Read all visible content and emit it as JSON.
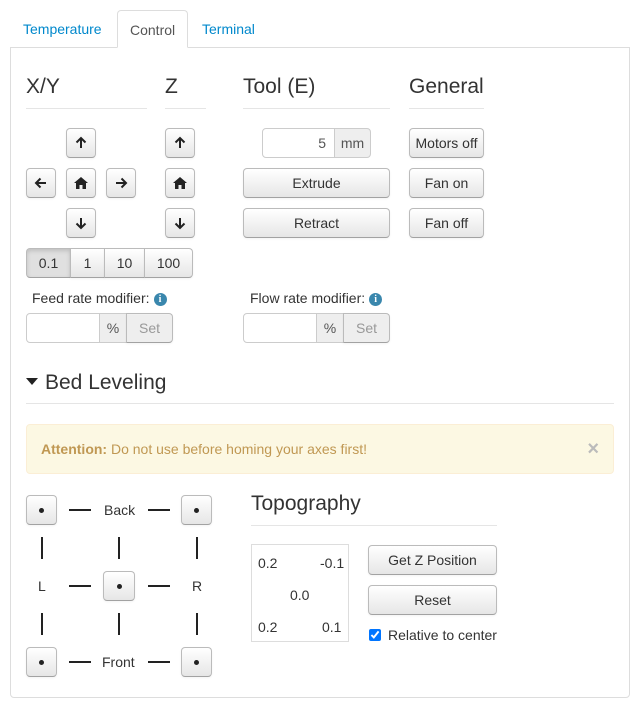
{
  "tabs": [
    {
      "label": "Temperature",
      "active": false
    },
    {
      "label": "Control",
      "active": true
    },
    {
      "label": "Terminal",
      "active": false
    }
  ],
  "sections": {
    "xy": "X/Y",
    "z": "Z",
    "tool": "Tool (E)",
    "general": "General"
  },
  "tool": {
    "amount": "5",
    "unit": "mm",
    "extrude": "Extrude",
    "retract": "Retract"
  },
  "general": {
    "motors_off": "Motors off",
    "fan_on": "Fan on",
    "fan_off": "Fan off"
  },
  "step_sizes": [
    {
      "label": "0.1",
      "active": true
    },
    {
      "label": "1",
      "active": false
    },
    {
      "label": "10",
      "active": false
    },
    {
      "label": "100",
      "active": false
    }
  ],
  "feed_rate": {
    "label": "Feed rate modifier:",
    "value": "",
    "unit": "%",
    "set": "Set"
  },
  "flow_rate": {
    "label": "Flow rate modifier:",
    "value": "",
    "unit": "%",
    "set": "Set"
  },
  "bed_leveling": {
    "title": "Bed Leveling",
    "alert_strong": "Attention:",
    "alert_text": " Do not use before homing your axes first!",
    "close": "×",
    "labels": {
      "back": "Back",
      "front": "Front",
      "left": "L",
      "right": "R"
    }
  },
  "topography": {
    "title": "Topography",
    "values": {
      "top_left": "0.2",
      "top_right": "-0.1",
      "center": "0.0",
      "bottom_left": "0.2",
      "bottom_right": "0.1"
    },
    "get_z": "Get Z Position",
    "reset": "Reset",
    "relative_label": "Relative to center",
    "relative_checked": true
  }
}
